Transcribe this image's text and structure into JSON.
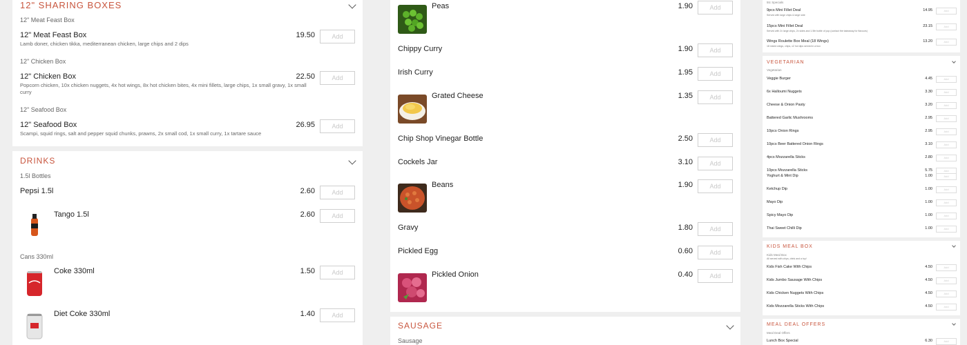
{
  "left": {
    "sharing": {
      "title": "12\" Sharing Boxes",
      "groups": [
        {
          "sub": "12\" Meat Feast Box",
          "name": "12\" Meat Feast Box",
          "desc": "Lamb doner, chicken tikka, mediterranean chicken, large chips and 2 dips",
          "price": "19.50"
        },
        {
          "sub": "12\" Chicken Box",
          "name": "12\" Chicken Box",
          "desc": "Popcorn chicken, 10x chicken nuggets, 4x hot wings, 8x hot chicken bites, 4x mini fillets, large chips, 1x small gravy, 1x small curry",
          "price": "22.50"
        },
        {
          "sub": "12\" Seafood Box",
          "name": "12\" Seafood Box",
          "desc": "Scampi, squid rings, salt and pepper squid chunks, prawns, 2x small cod, 1x small curry, 1x tartare sauce",
          "price": "26.95"
        }
      ]
    },
    "drinks": {
      "title": "Drinks",
      "sub1": "1.5l Bottles",
      "sub2": "Cans 330ml",
      "items": [
        {
          "name": "Pepsi 1.5l",
          "price": "2.60"
        },
        {
          "name": "Tango 1.5l",
          "price": "2.60"
        },
        {
          "name": "Coke 330ml",
          "price": "1.50"
        },
        {
          "name": "Diet Coke 330ml",
          "price": "1.40"
        }
      ]
    },
    "add_label": "Add"
  },
  "middle": {
    "items": [
      {
        "name": "Peas",
        "price": "1.90"
      },
      {
        "name": "Chippy Curry",
        "price": "1.90"
      },
      {
        "name": "Irish Curry",
        "price": "1.95"
      },
      {
        "name": "Grated Cheese",
        "price": "1.35"
      },
      {
        "name": "Chip Shop Vinegar Bottle",
        "price": "2.50"
      },
      {
        "name": "Cockels Jar",
        "price": "3.10"
      },
      {
        "name": "Beans",
        "price": "1.90"
      },
      {
        "name": "Gravy",
        "price": "1.80"
      },
      {
        "name": "Pickled Egg",
        "price": "0.60"
      },
      {
        "name": "Pickled Onion",
        "price": "0.40"
      }
    ],
    "sausage": {
      "title": "Sausage",
      "sub": "Sausage"
    }
  },
  "right": {
    "top_sub": "5tc Specials",
    "specials": [
      {
        "name": "9pcs Mini Fillet Deal",
        "desc": "Served with large chips & large side",
        "price": "14.95"
      },
      {
        "name": "15pcs Mini Fillet Deal",
        "desc": "Served with 2x large chips, 2x sides and 1.5ltr bottle of pop (contact the takeaway for flavours)",
        "price": "23.15"
      },
      {
        "name": "Wings Roulette Box Meal (18 Wings)",
        "desc": "18 mixed wings, chips, x2 hot dips served in a box",
        "price": "13.20"
      }
    ],
    "vegetarian": {
      "title": "Vegetarian",
      "sub": "Vegetarian",
      "items": [
        {
          "name": "Veggie Burger",
          "price": "4.45"
        },
        {
          "name": "6x Halloumi Nuggets",
          "price": "3.30"
        },
        {
          "name": "Cheese & Onion Pasty",
          "price": "3.20"
        },
        {
          "name": "Battered Garlic Mushrooms",
          "price": "2.95"
        },
        {
          "name": "10pcs Onion Rings",
          "price": "2.95"
        },
        {
          "name": "10pcs Beer Battered Onion Rings",
          "price": "3.10"
        },
        {
          "name": "4pcs Mozzarella Sticks",
          "price": "2.80"
        },
        {
          "name": "10pcs Mozzarella Sticks",
          "price": "5.75"
        }
      ]
    },
    "dips": [
      {
        "name": "Yoghurt & Mint Dip",
        "price": "1.00"
      },
      {
        "name": "Ketchup Dip",
        "price": "1.00"
      },
      {
        "name": "Mayo Dip",
        "price": "1.00"
      },
      {
        "name": "Spicy Mayo Dip",
        "price": "1.00"
      },
      {
        "name": "Thai Sweet Chilli Dip",
        "price": "1.00"
      }
    ],
    "kids": {
      "title": "Kids Meal Box",
      "sub": "Kids Meal Box",
      "sub_desc": "All served with chips, drink and a toy!",
      "items": [
        {
          "name": "Kids Fish Cake With Chips",
          "price": "4.50"
        },
        {
          "name": "Kids Jumbo Sausage With Chips",
          "price": "4.50"
        },
        {
          "name": "Kids Chicken Nuggets With Chips",
          "price": "4.50"
        },
        {
          "name": "Kids Mozzarella Sticks With Chips",
          "price": "4.50"
        }
      ]
    },
    "meal_deal": {
      "title": "Meal Deal Offers",
      "sub": "Meal Deal Offers",
      "items": [
        {
          "name": "Lunch Box Special",
          "price": "6.30"
        }
      ]
    },
    "add_label": "Add"
  }
}
